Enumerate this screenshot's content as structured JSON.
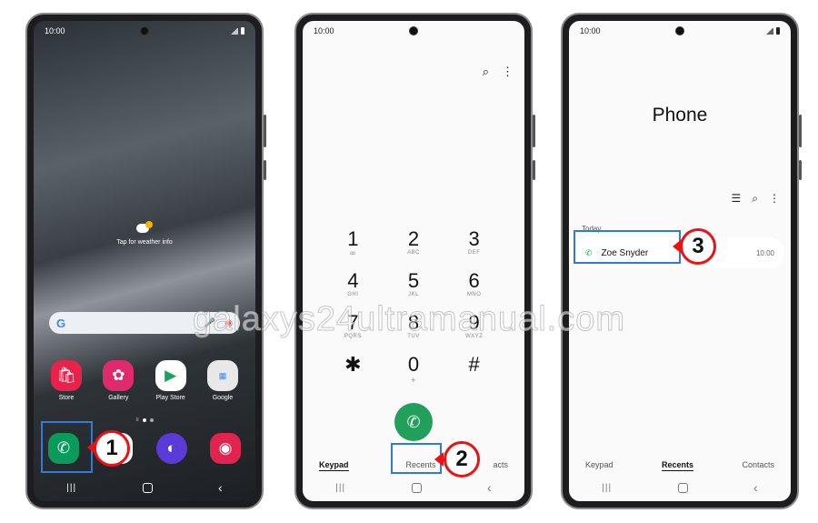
{
  "status_time": "10:00",
  "home": {
    "weather_label": "Tap for weather info",
    "apps": [
      {
        "label": "Store",
        "icon": "shopping-bag-icon"
      },
      {
        "label": "Gallery",
        "icon": "flower-icon"
      },
      {
        "label": "Play Store",
        "icon": "play-icon"
      },
      {
        "label": "Google",
        "icon": "google-folder-icon"
      }
    ],
    "dock": [
      {
        "icon": "phone-icon"
      },
      {
        "icon": "messages-icon"
      },
      {
        "icon": "internet-icon"
      },
      {
        "icon": "camera-icon"
      }
    ]
  },
  "keypad": {
    "keys": [
      {
        "n": "1",
        "l": "ꝏ"
      },
      {
        "n": "2",
        "l": "ABC"
      },
      {
        "n": "3",
        "l": "DEF"
      },
      {
        "n": "4",
        "l": "GHI"
      },
      {
        "n": "5",
        "l": "JKL"
      },
      {
        "n": "6",
        "l": "MNO"
      },
      {
        "n": "7",
        "l": "PQRS"
      },
      {
        "n": "8",
        "l": "TUV"
      },
      {
        "n": "9",
        "l": "WXYZ"
      },
      {
        "n": "✱",
        "l": ""
      },
      {
        "n": "0",
        "l": "+"
      },
      {
        "n": "#",
        "l": ""
      }
    ],
    "tabs": [
      "Keypad",
      "Recents",
      "Contacts"
    ],
    "contacts_partial": "acts"
  },
  "recents": {
    "title": "Phone",
    "section": "Today",
    "entries": [
      {
        "name": "Zoe Snyder",
        "time": "10:00"
      }
    ],
    "tabs": [
      "Keypad",
      "Recents",
      "Contacts"
    ]
  },
  "steps": [
    "1",
    "2",
    "3"
  ],
  "watermark": "galaxys24ultramanual.com",
  "colors": {
    "highlight": "#2f7bd9",
    "step_badge": "#ee1111",
    "call_green": "#22a05b"
  }
}
